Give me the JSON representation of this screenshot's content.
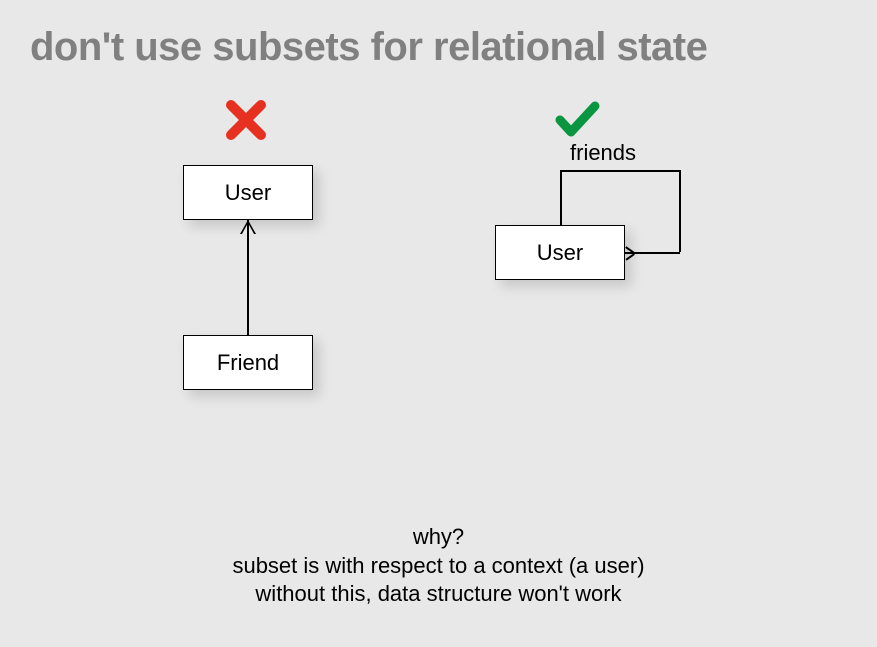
{
  "title": "don't use subsets for relational state",
  "left_diagram": {
    "top_box": "User",
    "bottom_box": "Friend"
  },
  "right_diagram": {
    "box": "User",
    "relation_label": "friends"
  },
  "explanation": {
    "line1": "why?",
    "line2": "subset is with respect to a context (a user)",
    "line3": "without this, data structure won't work"
  }
}
